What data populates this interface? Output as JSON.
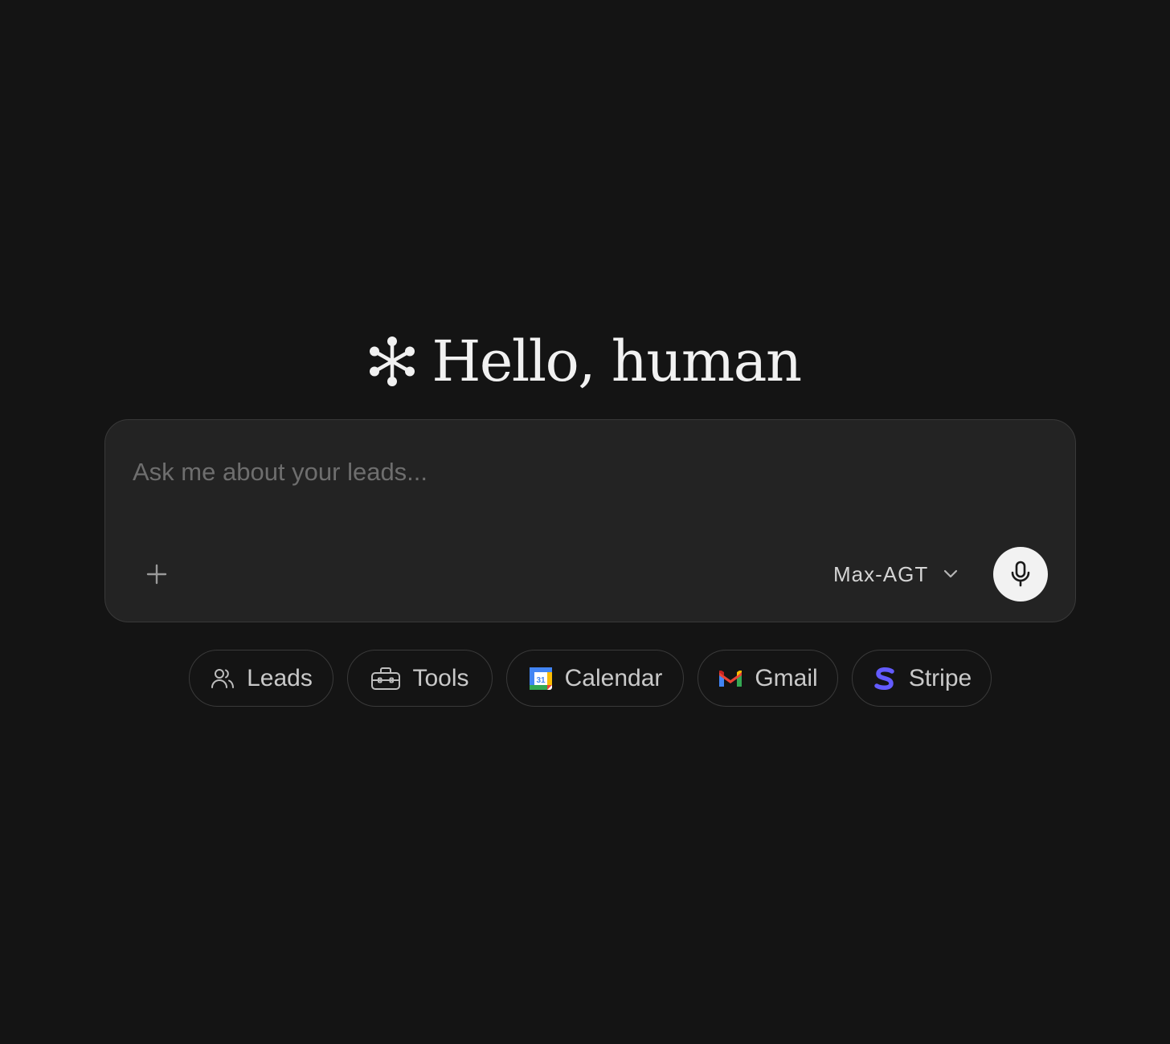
{
  "greeting": {
    "icon": "asterisk-nodes-icon",
    "text": "Hello, human"
  },
  "composer": {
    "placeholder": "Ask me about your leads...",
    "value": "",
    "add_icon": "plus-icon",
    "model": {
      "label": "Max-AGT",
      "icon": "chevron-down-icon"
    },
    "mic_icon": "microphone-icon"
  },
  "chips": [
    {
      "label": "Leads",
      "icon": "users-icon"
    },
    {
      "label": "Tools",
      "icon": "toolbox-icon"
    },
    {
      "label": "Calendar",
      "icon": "google-calendar-icon"
    },
    {
      "label": "Gmail",
      "icon": "gmail-icon"
    },
    {
      "label": "Stripe",
      "icon": "stripe-icon"
    }
  ],
  "colors": {
    "background": "#141414",
    "composer_background": "#232323",
    "border": "#393939",
    "mic_button": "#f2f2f2",
    "stripe_brand": "#635bff"
  }
}
